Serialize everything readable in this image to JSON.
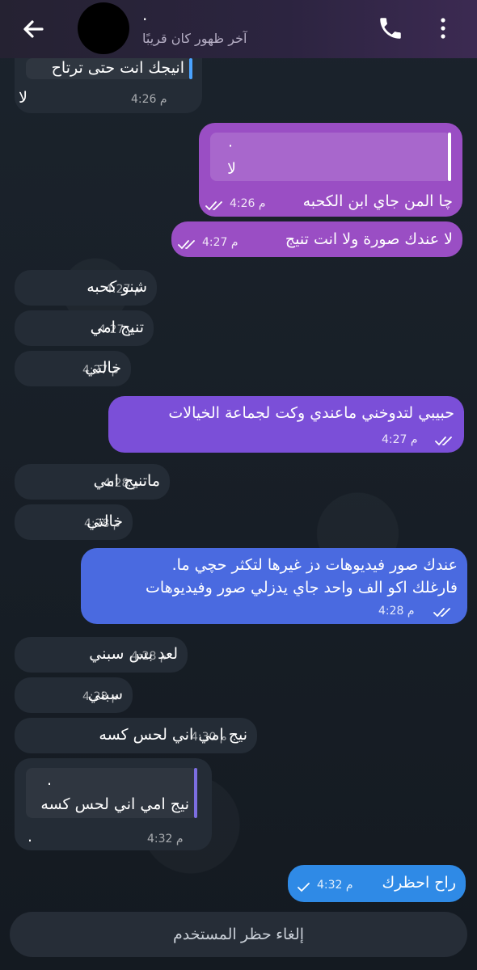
{
  "header": {
    "name": "·",
    "status": "آخر ظهور كان قريبًا"
  },
  "messages": [
    {
      "quote": "انيجك انت حتى ترتاح",
      "text": "لا",
      "time": "4:26 م"
    },
    {
      "quote_title": "·",
      "quote": "لا",
      "text": "چا المن جاي ابن الكحبه",
      "time": "4:26 م"
    },
    {
      "text": "لا عندك صورة ولا انت تنيج",
      "time": "4:27 م"
    },
    {
      "text": "شنو كحبه",
      "time": "4:27 م"
    },
    {
      "text": "تنيج امي",
      "time": "4:27 م"
    },
    {
      "text": "خالتي",
      "time": "4:27 م"
    },
    {
      "text": "حبيبي لتدوخني ماعندي وكت لجماعة الخيالات",
      "time": "4:27 م"
    },
    {
      "text": "ماتنيج امي",
      "time": "4:28 م"
    },
    {
      "text": "خالتي",
      "time": "4:28 م"
    },
    {
      "line1": "عندك صور فيديوهات دز غيرها لتكثر حچي ما.",
      "line2": "فارغلك اكو الف واحد جاي يدزلي صور وفيديوهات",
      "time": "4:28 م"
    },
    {
      "text": "لعد بس سبني",
      "time": "4:28 م"
    },
    {
      "text": "سبني",
      "time": "4:28 م"
    },
    {
      "text": "نيج امي اني لحس كسه",
      "time": "4:30 م"
    },
    {
      "quote_title": ".",
      "quote": "نيج امي اني لحس كسه",
      "text": ".",
      "time": "4:32 م"
    },
    {
      "text": "راح احظرك",
      "time": "4:32 م"
    }
  ],
  "footer": {
    "unblock_label": "إلغاء حظر المستخدم"
  },
  "colors": {
    "header": "#2c2440",
    "incoming": "#242c36",
    "outgoing_purple": "#9a4ec4",
    "outgoing_violet": "#7b4fd8",
    "outgoing_blue": "#4a6ae0",
    "outgoing_sky": "#2f8ae6"
  }
}
